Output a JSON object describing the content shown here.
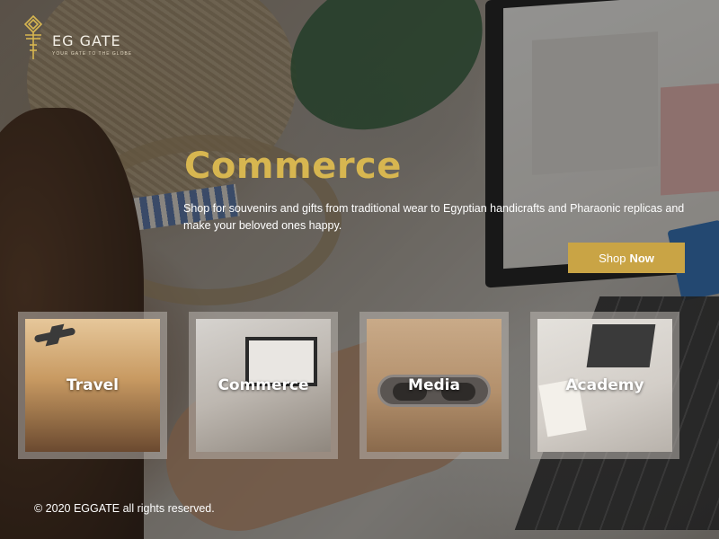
{
  "brand": {
    "name": "EG GATE",
    "tagline": "YOUR GATE TO THE GLOBE",
    "accent_color": "#d7b650",
    "button_color": "#c9a445"
  },
  "hero": {
    "title": "Commerce",
    "description": "Shop for souvenirs and gifts from traditional wear to Egyptian handicrafts and Pharaonic replicas and make your beloved ones happy.",
    "button_label_prefix": "Shop",
    "button_label_bold": "Now"
  },
  "categories": [
    {
      "label": "Travel"
    },
    {
      "label": "Commerce"
    },
    {
      "label": "Media"
    },
    {
      "label": "Academy"
    }
  ],
  "footer": {
    "copyright": "© 2020 EGGATE all rights reserved."
  }
}
